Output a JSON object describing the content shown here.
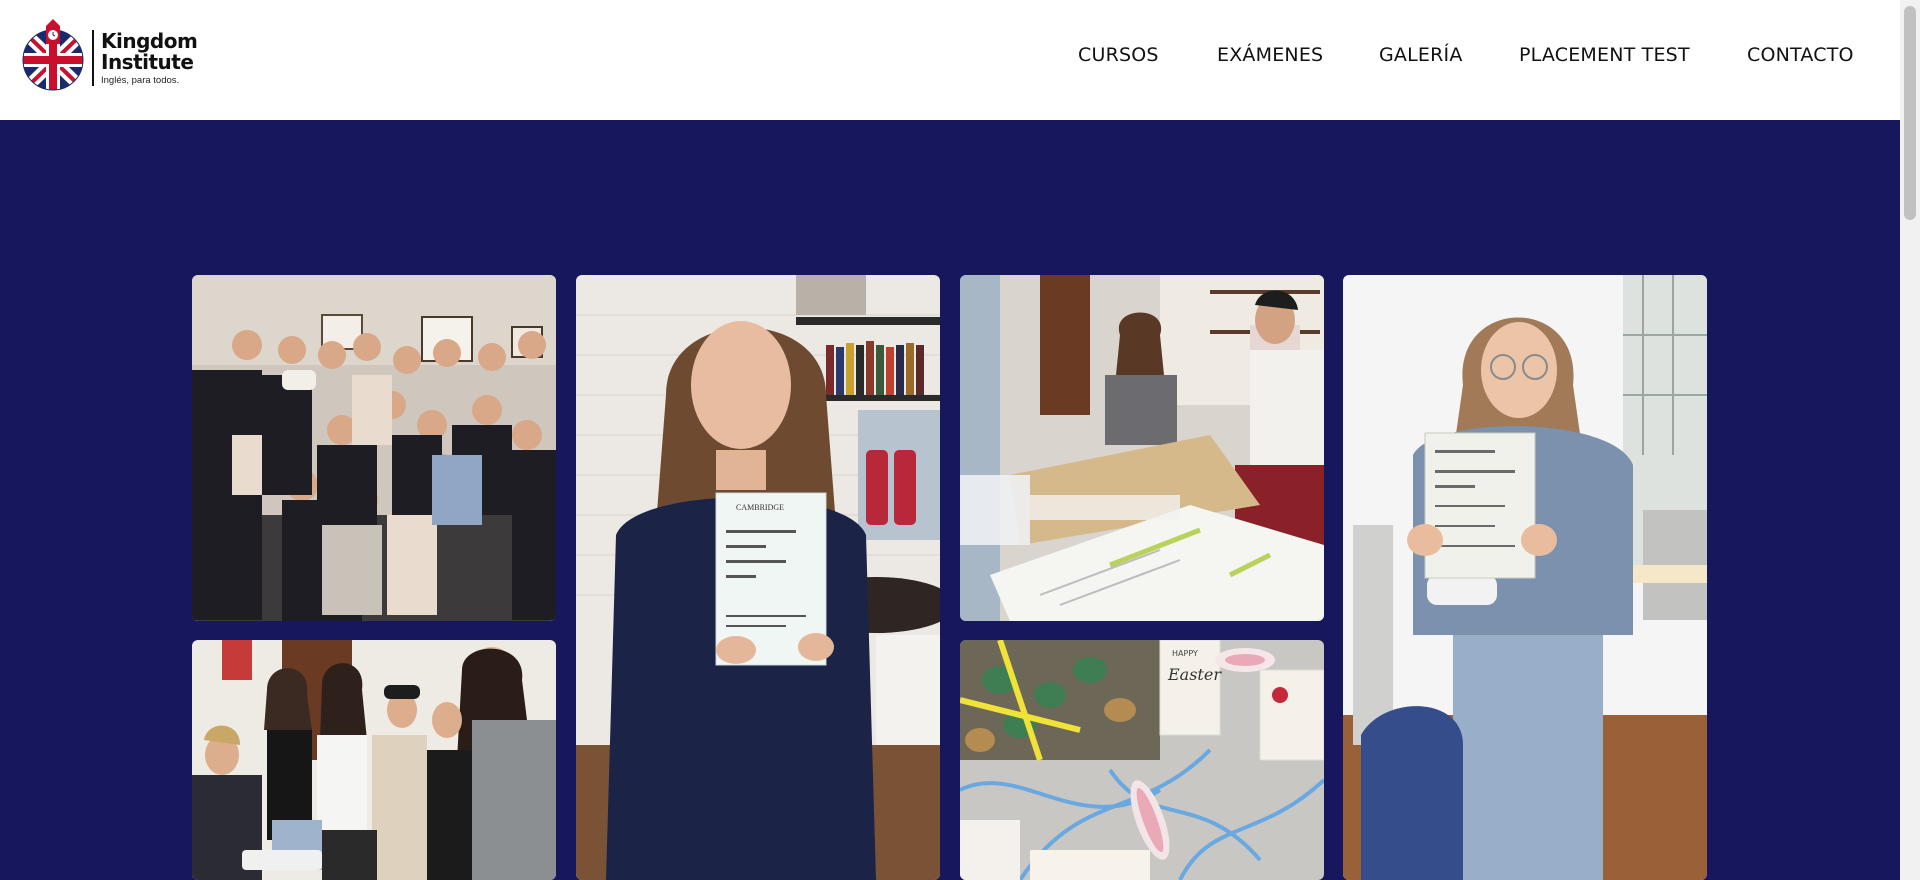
{
  "header": {
    "logo": {
      "name_line1": "Kingdom",
      "name_line2": "Institute",
      "tagline": "Inglés, para todos."
    },
    "nav": [
      {
        "label": "CURSOS"
      },
      {
        "label": "EXÁMENES"
      },
      {
        "label": "GALERÍA"
      },
      {
        "label": "PLACEMENT TEST"
      },
      {
        "label": "CONTACTO"
      }
    ]
  },
  "gallery": {
    "certificate_logo": "CAMBRIDGE",
    "easter_tag_line1": "HAPPY",
    "easter_tag_line2": "Easter"
  },
  "colors": {
    "page_background": "#17175e",
    "header_background": "#ffffff",
    "nav_text": "#111111"
  }
}
